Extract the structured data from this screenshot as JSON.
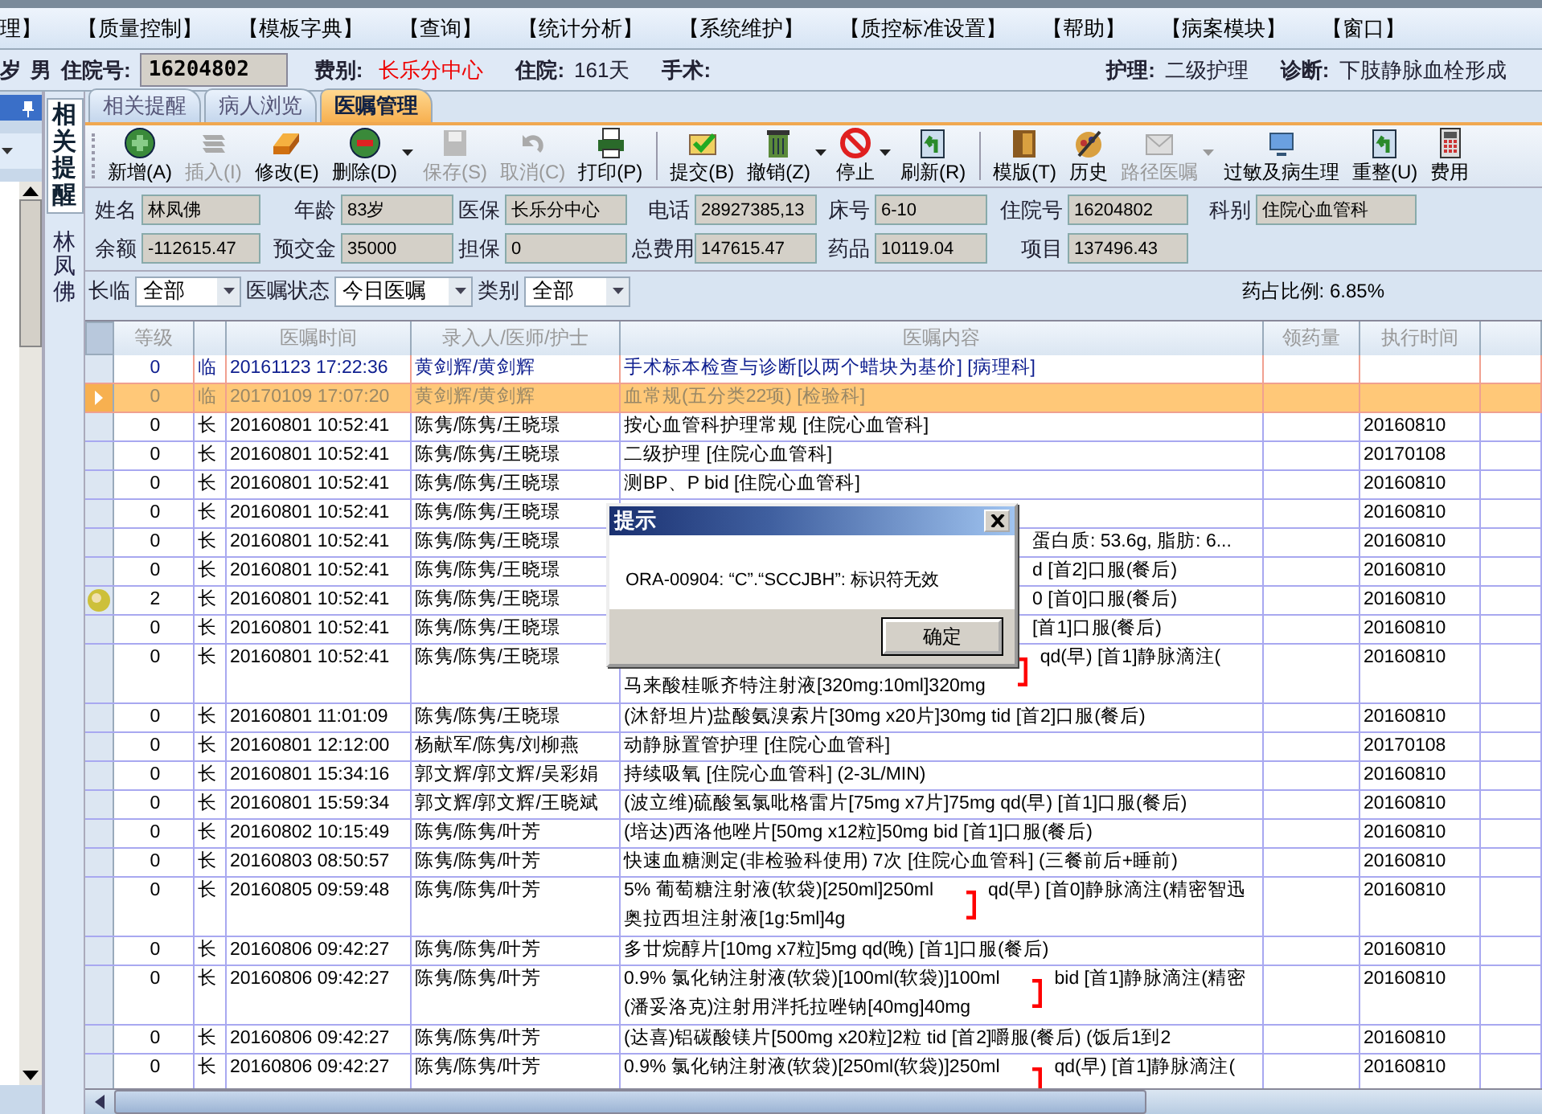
{
  "menu": [
    "理】",
    "【质量控制】",
    "【模板字典】",
    "【查询】",
    "【统计分析】",
    "【系统维护】",
    "【质控标准设置】",
    "【帮助】",
    "【病案模块】",
    "【窗口】"
  ],
  "patient_bar": {
    "age": "岁",
    "sex": "男",
    "admission_label": "住院号:",
    "admission_no": "16204802",
    "fee_label": "费别:",
    "fee_type": "长乐分中心",
    "stay_label": "住院:",
    "stay": "161天",
    "surgery_label": "手术:",
    "nursing_label": "护理:",
    "nursing": "二级护理",
    "diagnosis_label": "诊断:",
    "diagnosis": "下肢静脉血栓形成"
  },
  "side_tab": {
    "label": "相关提醒",
    "patient": "林凤佛"
  },
  "tabs": [
    {
      "label": "相关提醒",
      "selected": false
    },
    {
      "label": "病人浏览",
      "selected": false
    },
    {
      "label": "医嘱管理",
      "selected": true
    }
  ],
  "toolbar": [
    {
      "label": "新增(A)",
      "disabled": false,
      "dropdown": false
    },
    {
      "label": "插入(I)",
      "disabled": true,
      "dropdown": false
    },
    {
      "label": "修改(E)",
      "disabled": false,
      "dropdown": false
    },
    {
      "label": "删除(D)",
      "disabled": false,
      "dropdown": true
    },
    {
      "label": "保存(S)",
      "disabled": true,
      "dropdown": false
    },
    {
      "label": "取消(C)",
      "disabled": true,
      "dropdown": false
    },
    {
      "label": "打印(P)",
      "disabled": false,
      "dropdown": false
    },
    {
      "label": "提交(B)",
      "disabled": false,
      "dropdown": false
    },
    {
      "label": "撤销(Z)",
      "disabled": false,
      "dropdown": true
    },
    {
      "label": "停止",
      "disabled": false,
      "dropdown": true
    },
    {
      "label": "刷新(R)",
      "disabled": false,
      "dropdown": false
    },
    {
      "label": "模版(T)",
      "disabled": false,
      "dropdown": false
    },
    {
      "label": "历史",
      "disabled": false,
      "dropdown": false
    },
    {
      "label": "路径医嘱",
      "disabled": true,
      "dropdown": true
    },
    {
      "label": "过敏及病生理",
      "disabled": false,
      "dropdown": false
    },
    {
      "label": "重整(U)",
      "disabled": false,
      "dropdown": false
    },
    {
      "label": "费用",
      "disabled": false,
      "dropdown": false
    }
  ],
  "info": [
    [
      {
        "label": "姓名",
        "value": "林凤佛"
      },
      {
        "label": "年龄",
        "value": "83岁"
      },
      {
        "label": "医保",
        "value": "长乐分中心"
      },
      {
        "label": "电话",
        "value": "28927385,13"
      },
      {
        "label": "床号",
        "value": "6-10"
      },
      {
        "label": "住院号",
        "value": "16204802"
      },
      {
        "label": "科别",
        "value": "住院心血管科"
      }
    ],
    [
      {
        "label": "余额",
        "value": "-112615.47"
      },
      {
        "label": "预交金",
        "value": "35000"
      },
      {
        "label": "担保",
        "value": "0"
      },
      {
        "label": "总费用",
        "value": "147615.47"
      },
      {
        "label": "药品",
        "value": "10119.04"
      },
      {
        "label": "项目",
        "value": "137496.43"
      }
    ]
  ],
  "filters": [
    {
      "label": "长临",
      "value": "全部"
    },
    {
      "label": "医嘱状态",
      "value": "今日医嘱"
    },
    {
      "label": "类别",
      "value": "全部"
    }
  ],
  "drug_ratio": "药占比例: 6.85%",
  "table": {
    "columns": [
      "等级",
      "医嘱时间",
      "录入人/医师/护士",
      "医嘱内容",
      "领药量",
      "执行时间"
    ],
    "rows": [
      {
        "level": "0",
        "type": "临",
        "time": "20161123 17:22:36",
        "staff": "黄剑辉/黄剑辉",
        "new": true,
        "selected": false,
        "flag": false,
        "covered": false,
        "content": {
          "kind": "single",
          "text": "手术标本检查与诊断[以两个蜡块为基价]   [病理科]"
        }
      },
      {
        "level": "0",
        "type": "临",
        "time": "20170109 17:07:20",
        "staff": "黄剑辉/黄剑辉",
        "new": true,
        "selected": true,
        "flag": false,
        "covered": false,
        "content": {
          "kind": "single",
          "text": "血常规(五分类22项)   [检验科]"
        }
      },
      {
        "level": "0",
        "type": "长",
        "time": "20160801 10:52:41",
        "staff": "陈隽/陈隽/王晓璟",
        "new": false,
        "selected": false,
        "flag": false,
        "covered": false,
        "exec": "20160810",
        "content": {
          "kind": "single",
          "text": "按心血管科护理常规   [住院心血管科]"
        }
      },
      {
        "level": "0",
        "type": "长",
        "time": "20160801 10:52:41",
        "staff": "陈隽/陈隽/王晓璟",
        "new": false,
        "selected": false,
        "flag": false,
        "covered": false,
        "exec": "20170108",
        "content": {
          "kind": "single",
          "text": "二级护理   [住院心血管科]"
        }
      },
      {
        "level": "0",
        "type": "长",
        "time": "20160801 10:52:41",
        "staff": "陈隽/陈隽/王晓璟",
        "new": false,
        "selected": false,
        "flag": false,
        "covered": false,
        "exec": "20160810",
        "content": {
          "kind": "single",
          "text": "测BP、P bid   [住院心血管科]"
        }
      },
      {
        "level": "0",
        "type": "长",
        "time": "20160801 10:52:41",
        "staff": "陈隽/陈隽/王晓璟",
        "new": false,
        "selected": false,
        "flag": false,
        "exec": "20160810",
        "content": {
          "kind": "none"
        }
      },
      {
        "level": "0",
        "type": "长",
        "time": "20160801 10:52:41",
        "staff": "陈隽/陈隽/王晓璟",
        "new": false,
        "selected": false,
        "flag": false,
        "covered": true,
        "exec": "20160810",
        "content": {
          "kind": "single",
          "text": "蛋白质: 53.6g, 脂肪: 6..."
        }
      },
      {
        "level": "0",
        "type": "长",
        "time": "20160801 10:52:41",
        "staff": "陈隽/陈隽/王晓璟",
        "new": false,
        "selected": false,
        "flag": false,
        "covered": true,
        "exec": "20160810",
        "content": {
          "kind": "single",
          "text": "d [首2]口服(餐后)"
        }
      },
      {
        "level": "2",
        "type": "长",
        "time": "20160801 10:52:41",
        "staff": "陈隽/陈隽/王晓璟",
        "new": false,
        "selected": false,
        "flag": true,
        "covered": true,
        "exec": "20160810",
        "content": {
          "kind": "single",
          "text": "0 [首0]口服(餐后)"
        }
      },
      {
        "level": "0",
        "type": "长",
        "time": "20160801 10:52:41",
        "staff": "陈隽/陈隽/王晓璟",
        "new": false,
        "selected": false,
        "flag": false,
        "covered": true,
        "exec": "20160810",
        "content": {
          "kind": "single",
          "text": "[首1]口服(餐后)"
        }
      },
      {
        "level": "0",
        "type": "长",
        "time": "20160801 10:52:41",
        "staff": "陈隽/陈隽/王晓璟",
        "new": false,
        "selected": false,
        "flag": false,
        "covered": true,
        "exec": "20160810",
        "content": {
          "kind": "group",
          "lines": [
            "马来酸桂哌齐特注射液[320mg:10ml]320mg"
          ],
          "route": "qd(早) [首1]静脉滴注("
        }
      },
      {
        "level": "0",
        "type": "长",
        "time": "20160801 11:01:09",
        "staff": "陈隽/陈隽/王晓璟",
        "new": false,
        "selected": false,
        "flag": false,
        "covered": false,
        "exec": "20160810",
        "content": {
          "kind": "single",
          "text": "(沐舒坦片)盐酸氨溴索片[30mg x20片]30mg  tid [首2]口服(餐后)"
        }
      },
      {
        "level": "0",
        "type": "长",
        "time": "20160801 12:12:00",
        "staff": "杨献军/陈隽/刘柳燕",
        "new": false,
        "selected": false,
        "flag": false,
        "covered": false,
        "exec": "20170108",
        "content": {
          "kind": "single",
          "text": "动静脉置管护理   [住院心血管科]"
        }
      },
      {
        "level": "0",
        "type": "长",
        "time": "20160801 15:34:16",
        "staff": "郭文辉/郭文辉/吴彩娟",
        "new": false,
        "selected": false,
        "flag": false,
        "covered": false,
        "exec": "20160810",
        "content": {
          "kind": "single",
          "text": "持续吸氧   [住院心血管科]  (2-3L/MIN)"
        }
      },
      {
        "level": "0",
        "type": "长",
        "time": "20160801 15:59:34",
        "staff": "郭文辉/郭文辉/王晓斌",
        "new": false,
        "selected": false,
        "flag": false,
        "covered": false,
        "exec": "20160810",
        "content": {
          "kind": "single",
          "text": "(波立维)硫酸氢氯吡格雷片[75mg x7片]75mg  qd(早) [首1]口服(餐后)"
        }
      },
      {
        "level": "0",
        "type": "长",
        "time": "20160802 10:15:49",
        "staff": "陈隽/陈隽/叶芳",
        "new": false,
        "selected": false,
        "flag": false,
        "covered": false,
        "exec": "20160810",
        "content": {
          "kind": "single",
          "text": "(培达)西洛他唑片[50mg x12粒]50mg  bid [首1]口服(餐后)"
        }
      },
      {
        "level": "0",
        "type": "长",
        "time": "20160803 08:50:57",
        "staff": "陈隽/陈隽/叶芳",
        "new": false,
        "selected": false,
        "flag": false,
        "covered": false,
        "exec": "20160810",
        "content": {
          "kind": "single",
          "text": "快速血糖测定(非检验科使用) 7次  [住院心血管科]  (三餐前后+睡前)"
        }
      },
      {
        "level": "0",
        "type": "长",
        "time": "20160805 09:59:48",
        "staff": "陈隽/陈隽/叶芳",
        "new": false,
        "selected": false,
        "flag": false,
        "covered": false,
        "exec": "20160810",
        "content": {
          "kind": "group",
          "lines": [
            "5% 葡萄糖注射液(软袋)[250ml]250ml",
            "奥拉西坦注射液[1g:5ml]4g"
          ],
          "route": "qd(早) [首0]静脉滴注(精密智迅"
        }
      },
      {
        "level": "0",
        "type": "长",
        "time": "20160806 09:42:27",
        "staff": "陈隽/陈隽/叶芳",
        "new": false,
        "selected": false,
        "flag": false,
        "covered": false,
        "exec": "20160810",
        "content": {
          "kind": "single",
          "text": "多廿烷醇片[10mg x7粒]5mg  qd(晚) [首1]口服(餐后)"
        }
      },
      {
        "level": "0",
        "type": "长",
        "time": "20160806 09:42:27",
        "staff": "陈隽/陈隽/叶芳",
        "new": false,
        "selected": false,
        "flag": false,
        "covered": false,
        "exec": "20160810",
        "content": {
          "kind": "group",
          "lines": [
            "0.9% 氯化钠注射液(软袋)[100ml(软袋)]100ml",
            "(潘妥洛克)注射用泮托拉唑钠[40mg]40mg"
          ],
          "route": "bid [首1]静脉滴注(精密"
        }
      },
      {
        "level": "0",
        "type": "长",
        "time": "20160806 09:42:27",
        "staff": "陈隽/陈隽/叶芳",
        "new": false,
        "selected": false,
        "flag": false,
        "covered": false,
        "exec": "20160810",
        "content": {
          "kind": "single",
          "text": "(达喜)铝碳酸镁片[500mg x20粒]2粒  tid [首2]嚼服(餐后) (饭后1到2"
        }
      },
      {
        "level": "0",
        "type": "长",
        "time": "20160806 09:42:27",
        "staff": "陈隽/陈隽/叶芳",
        "new": false,
        "selected": false,
        "flag": false,
        "covered": false,
        "exec": "20160810",
        "content": {
          "kind": "group",
          "lines": [
            "0.9% 氯化钠注射液(软袋)[250ml(软袋)]250ml"
          ],
          "route": "qd(早) [首1]静脉滴注("
        }
      }
    ]
  },
  "dialog": {
    "title": "提示",
    "message": "ORA-00904: “C”.“SCCJBH”: 标识符无效",
    "button": "确定"
  }
}
